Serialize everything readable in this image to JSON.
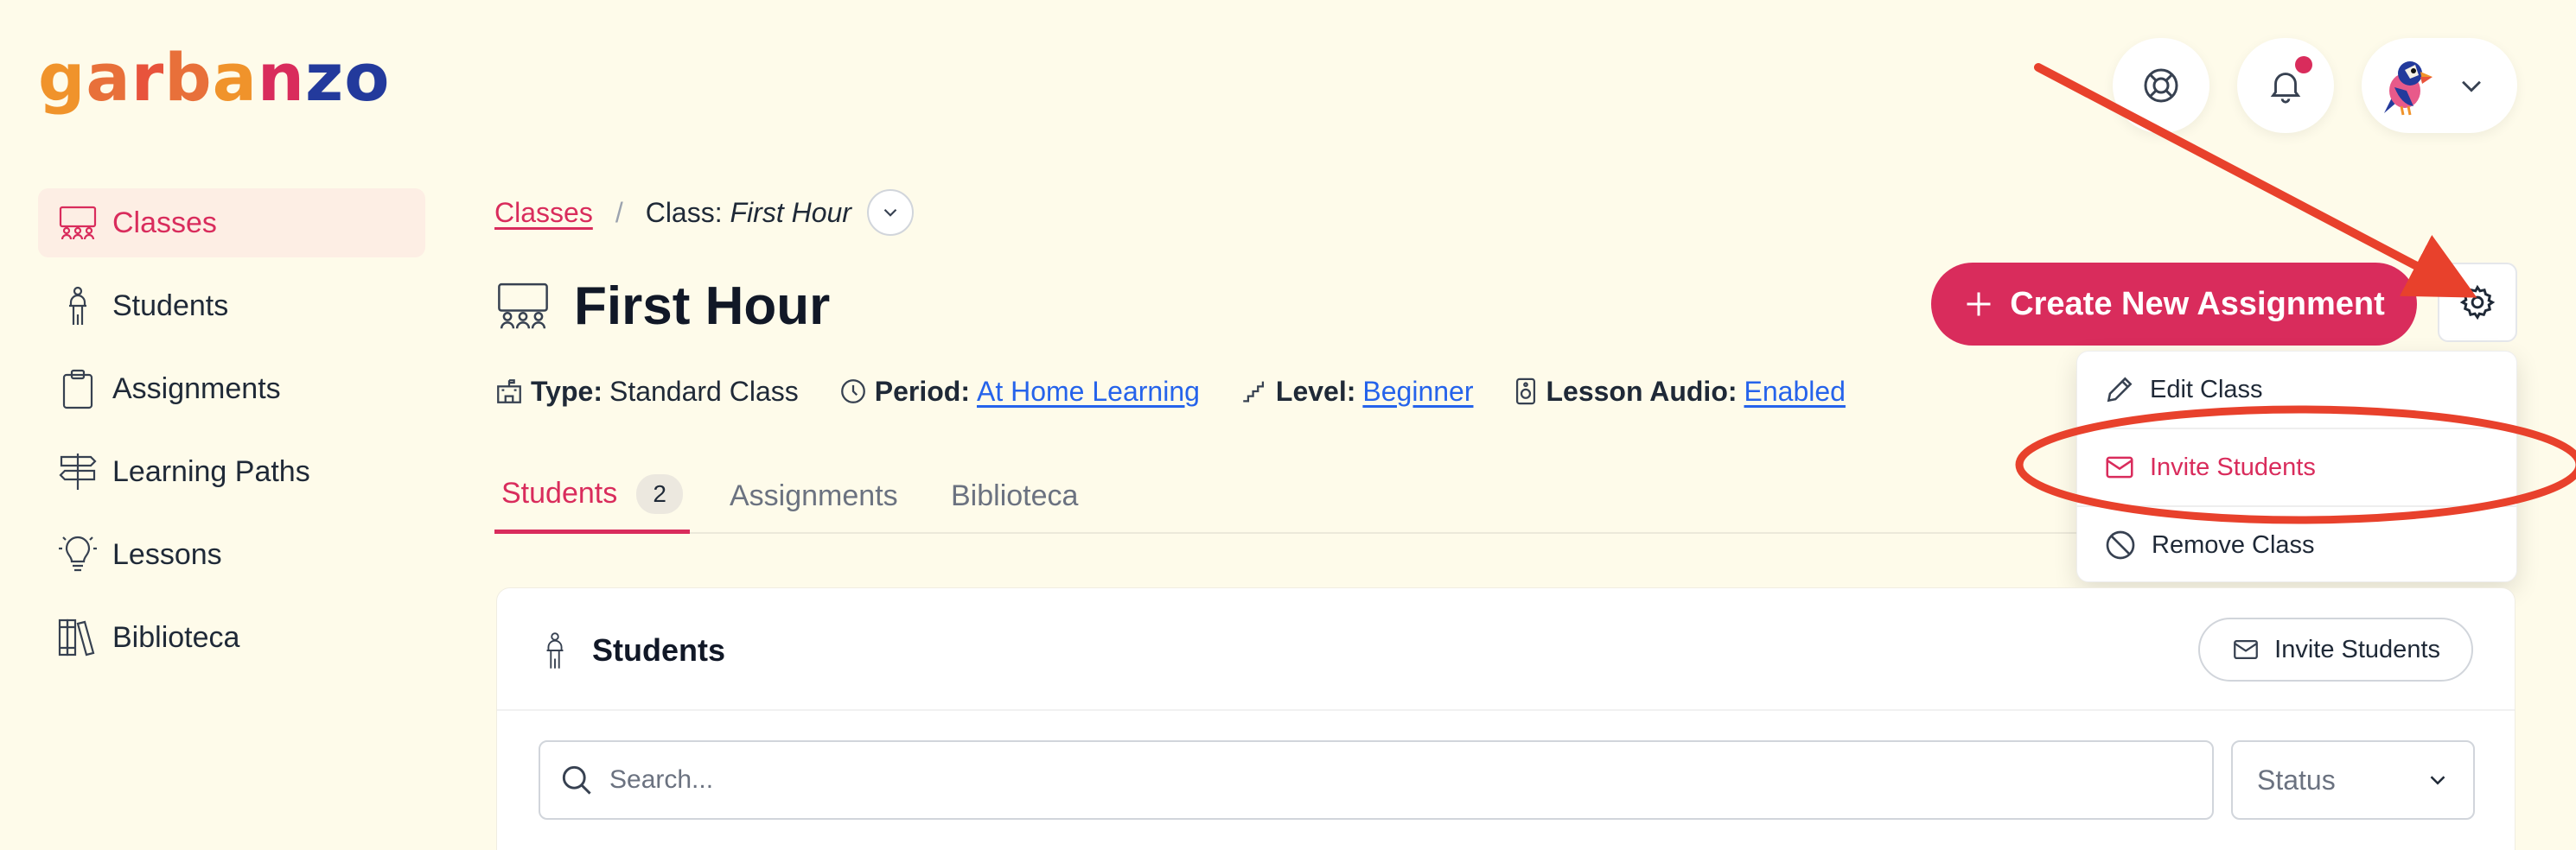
{
  "brand": {
    "logo_letters": [
      "g",
      "a",
      "r",
      "b",
      "a",
      "n",
      "z",
      "o"
    ],
    "logo_colors": [
      "#f0932b",
      "#e8703a",
      "#e8533c",
      "#e8703a",
      "#f0932b",
      "#d92c5c",
      "#233a9c",
      "#233a9c"
    ]
  },
  "colors": {
    "accent": "#d92c5c",
    "link": "#2563eb",
    "background": "#fefbea",
    "annotation": "#e8412c"
  },
  "header": {
    "help_icon": "lifebuoy-icon",
    "notifications_icon": "bell-icon",
    "profile_icon": "chevron-down-icon"
  },
  "sidebar": {
    "items": [
      {
        "label": "Classes",
        "icon": "classroom-icon",
        "active": true
      },
      {
        "label": "Students",
        "icon": "student-icon"
      },
      {
        "label": "Assignments",
        "icon": "clipboard-icon"
      },
      {
        "label": "Learning Paths",
        "icon": "signpost-icon"
      },
      {
        "label": "Lessons",
        "icon": "lightbulb-icon"
      },
      {
        "label": "Biblioteca",
        "icon": "books-icon"
      }
    ]
  },
  "breadcrumb": {
    "root": "Classes",
    "separator": "/",
    "current_prefix": "Class:",
    "current_name": "First Hour"
  },
  "page": {
    "title": "First Hour"
  },
  "meta": {
    "type_label": "Type:",
    "type_value": "Standard Class",
    "period_label": "Period:",
    "period_value": "At Home Learning",
    "level_label": "Level:",
    "level_value": "Beginner",
    "audio_label": "Lesson Audio:",
    "audio_value": "Enabled"
  },
  "tabs": [
    {
      "label": "Students",
      "count": "2",
      "active": true
    },
    {
      "label": "Assignments"
    },
    {
      "label": "Biblioteca"
    }
  ],
  "actions": {
    "create_label": "Create New Assignment"
  },
  "settings_menu": {
    "items": [
      {
        "label": "Edit Class",
        "icon": "pencil-icon"
      },
      {
        "label": "Invite Students",
        "icon": "envelope-icon"
      },
      {
        "label": "Remove Class",
        "icon": "ban-icon"
      }
    ]
  },
  "students_panel": {
    "title": "Students",
    "invite_label": "Invite Students",
    "search_placeholder": "Search...",
    "status_label": "Status"
  }
}
